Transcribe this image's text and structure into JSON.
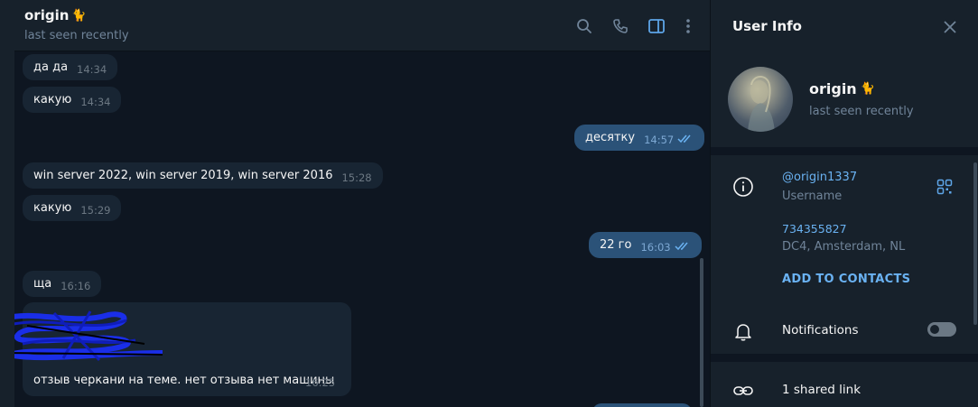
{
  "chat": {
    "title": "origin",
    "title_emoji": "🐈",
    "status": "last seen recently",
    "messages": [
      {
        "text": "да да",
        "time": "14:34",
        "outgoing": false
      },
      {
        "text": "какую",
        "time": "14:34",
        "outgoing": false
      },
      {
        "text": "десятку",
        "time": "14:57",
        "outgoing": true
      },
      {
        "text": "win server 2022, win server 2019, win server 2016",
        "time": "15:28",
        "outgoing": false
      },
      {
        "text": "какую",
        "time": "15:29",
        "outgoing": false
      },
      {
        "text": "22 го",
        "time": "16:03",
        "outgoing": true
      },
      {
        "text": "ща",
        "time": "16:16",
        "outgoing": false
      },
      {
        "text": "отзыв черкани на теме. нет отзыва нет машины",
        "time": "16:25",
        "outgoing": false
      }
    ]
  },
  "header_icons": [
    "search-icon",
    "phone-icon",
    "sidebar-toggle-icon",
    "more-icon"
  ],
  "info": {
    "title": "User Info",
    "name": "origin",
    "status": "last seen recently",
    "username": "@origin1337",
    "username_label": "Username",
    "phone_id": "734355827",
    "dc": "DC4, Amsterdam, NL",
    "add_contact": "ADD TO CONTACTS",
    "notifications": "Notifications",
    "notifications_on": false,
    "shared_links": "1 shared link"
  },
  "colors": {
    "accent": "#6ab2f2",
    "background": "#0e1621",
    "panel": "#17212b",
    "incoming_bubble": "#182533",
    "outgoing_bubble": "#2b5278"
  }
}
